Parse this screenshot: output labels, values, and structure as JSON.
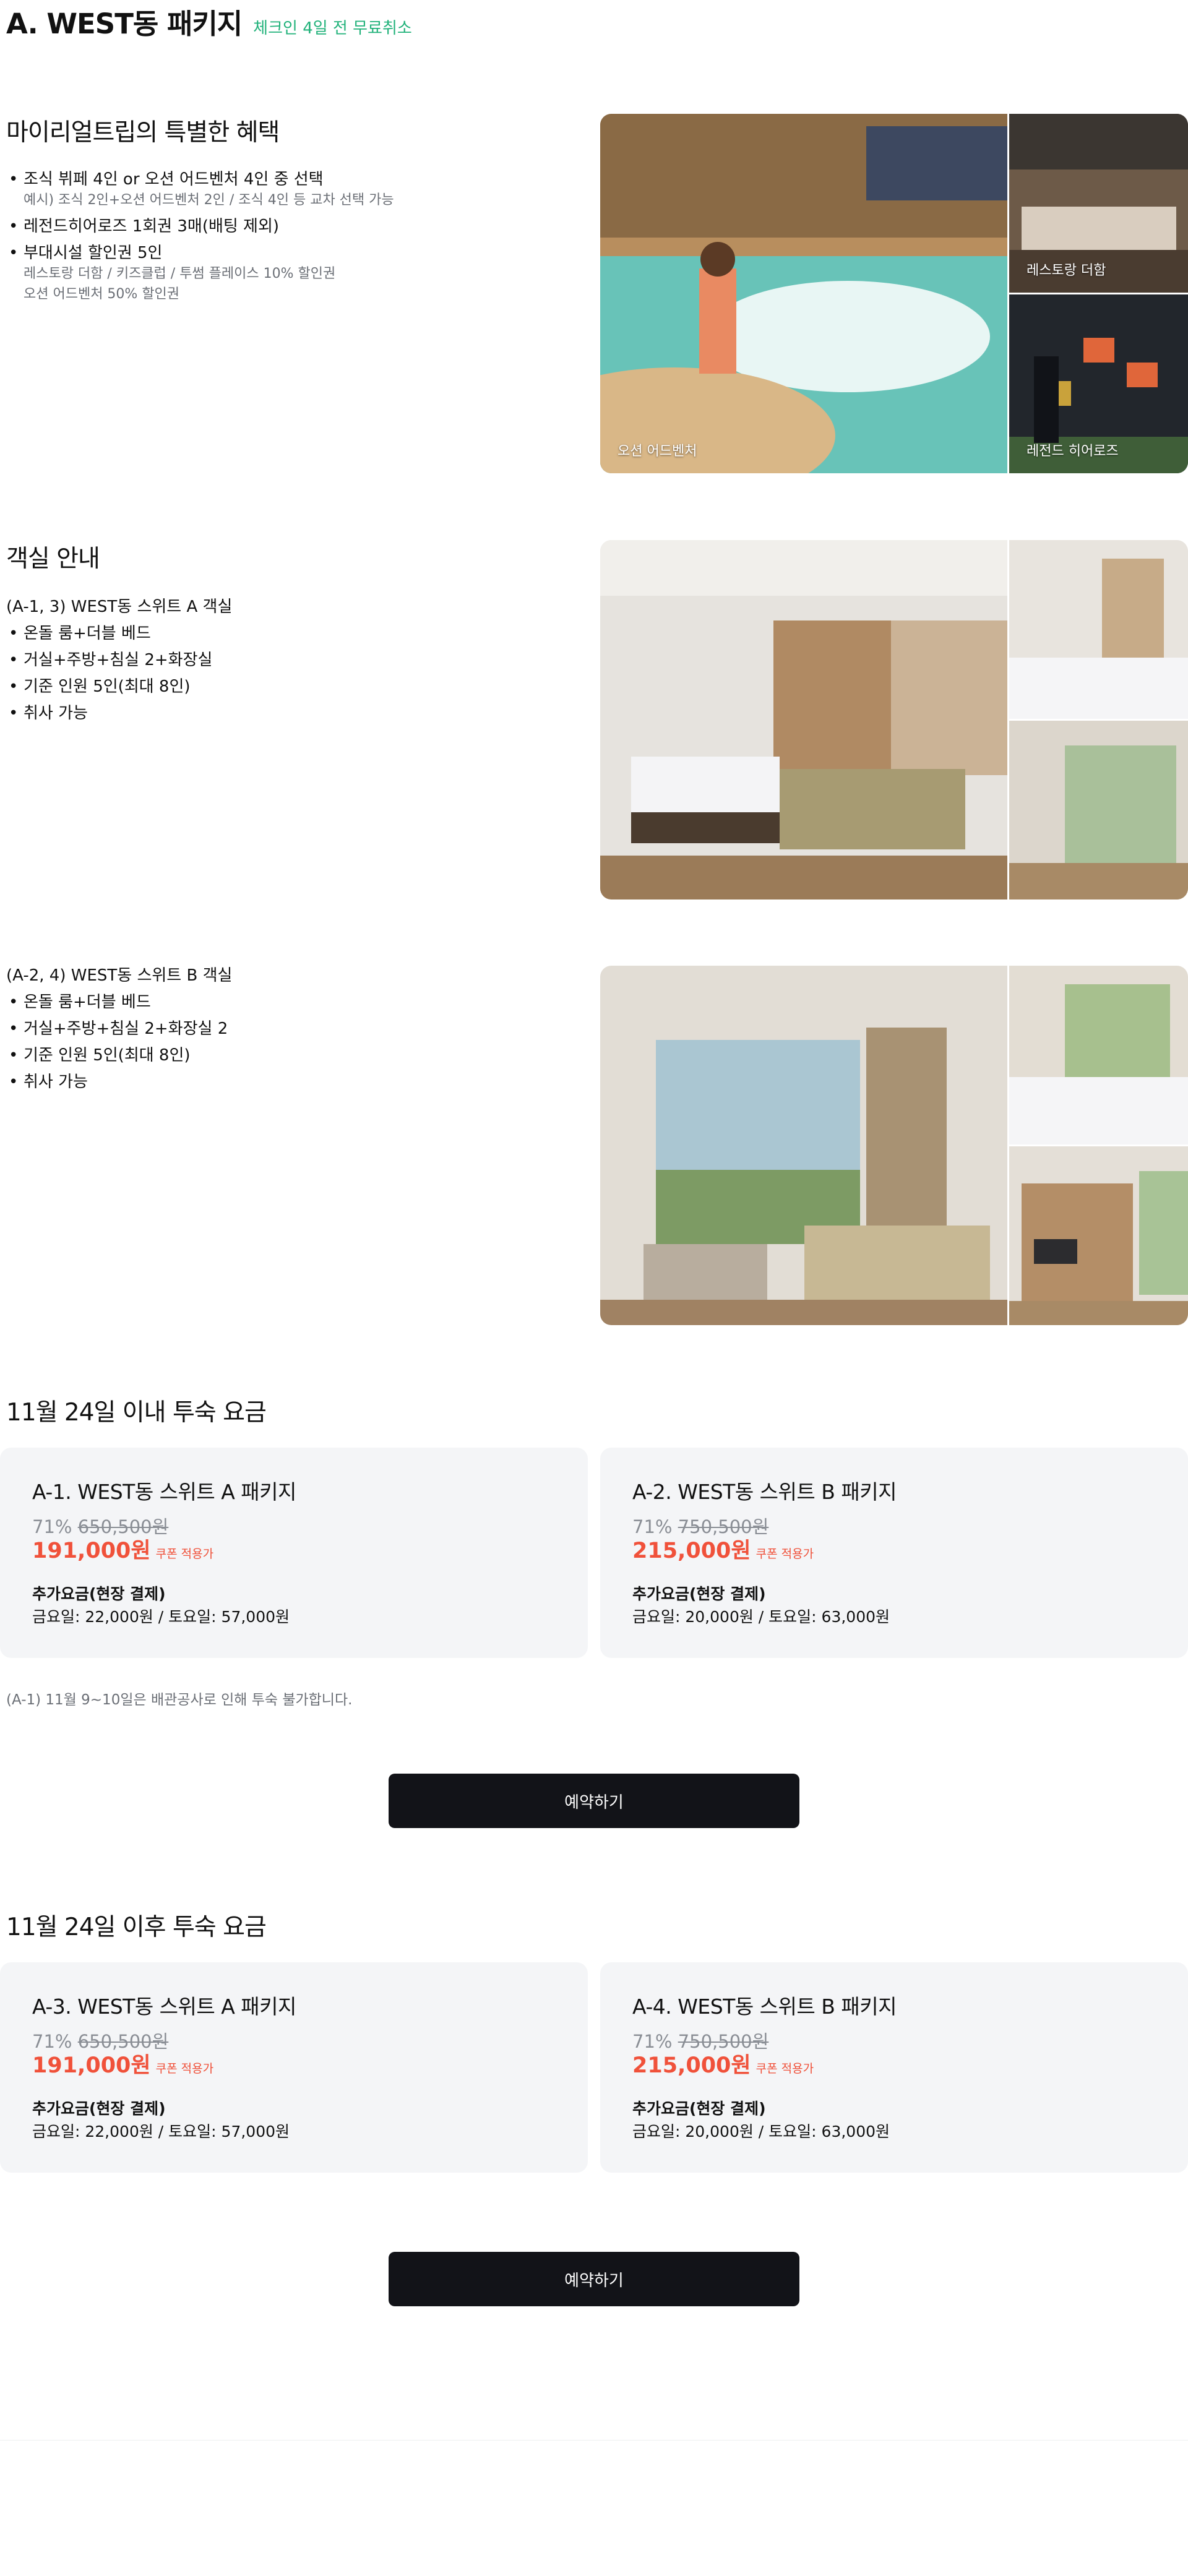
{
  "header": {
    "title": "A. WEST동 패키지",
    "cancel_note": "체크인 4일 전 무료취소"
  },
  "benefits": {
    "title": "마이리얼트립의 특별한 혜택",
    "items": [
      {
        "text": "조식 뷔페 4인 or 오션 어드벤처 4인 중 선택",
        "sub": [
          "예시) 조식 2인+오션 어드벤처 2인 / 조식 4인 등 교차 선택 가능"
        ]
      },
      {
        "text": "레전드히어로즈 1회권 3매(배팅 제외)",
        "sub": []
      },
      {
        "text": "부대시설 할인권 5인",
        "sub": [
          "레스토랑 더함 / 키즈클럽 / 투썸 플레이스 10% 할인권",
          "오션 어드벤처 50% 할인권"
        ]
      }
    ],
    "gallery": {
      "main": "오션 어드벤처",
      "top": "레스토랑 더함",
      "bottom": "레전드 히어로즈"
    }
  },
  "rooms": {
    "title": "객실 안내",
    "a": {
      "head": "(A-1, 3) WEST동 스위트 A 객실",
      "items": [
        "온돌 룸+더블 베드",
        "거실+주방+침실 2+화장실",
        "기준 인원 5인(최대 8인)",
        "취사 가능"
      ]
    },
    "b": {
      "head": "(A-2, 4) WEST동 스위트 B 객실",
      "items": [
        "온돌 룸+더블 베드",
        "거실+주방+침실 2+화장실 2",
        "기준 인원 5인(최대 8인)",
        "취사 가능"
      ]
    }
  },
  "pricing_before": {
    "title": "11월 24일 이내 투숙 요금",
    "cards": [
      {
        "title": "A-1. WEST동 스위트 A 패키지",
        "discount": "71%",
        "original": "650,500원",
        "sale": "191,000원",
        "coupon": "쿠폰 적용가",
        "extra_label": "추가요금(현장 결제)",
        "extra_value": "금요일: 22,000원 / 토요일: 57,000원"
      },
      {
        "title": "A-2. WEST동 스위트 B 패키지",
        "discount": "71%",
        "original": "750,500원",
        "sale": "215,000원",
        "coupon": "쿠폰 적용가",
        "extra_label": "추가요금(현장 결제)",
        "extra_value": "금요일: 20,000원 / 토요일: 63,000원"
      }
    ],
    "notice": "(A-1) 11월 9~10일은 배관공사로 인해 투숙 불가합니다.",
    "button": "예약하기"
  },
  "pricing_after": {
    "title": "11월 24일 이후 투숙 요금",
    "cards": [
      {
        "title": "A-3. WEST동 스위트 A 패키지",
        "discount": "71%",
        "original": "650,500원",
        "sale": "191,000원",
        "coupon": "쿠폰 적용가",
        "extra_label": "추가요금(현장 결제)",
        "extra_value": "금요일: 22,000원 / 토요일: 57,000원"
      },
      {
        "title": "A-4. WEST동 스위트 B 패키지",
        "discount": "71%",
        "original": "750,500원",
        "sale": "215,000원",
        "coupon": "쿠폰 적용가",
        "extra_label": "추가요금(현장 결제)",
        "extra_value": "금요일: 20,000원 / 토요일: 63,000원"
      }
    ],
    "button": "예약하기"
  },
  "colors": {
    "accent_green": "#21b27a",
    "sale_red": "#f0513a",
    "button_dark": "#121318",
    "card_bg": "#f4f5f7"
  }
}
